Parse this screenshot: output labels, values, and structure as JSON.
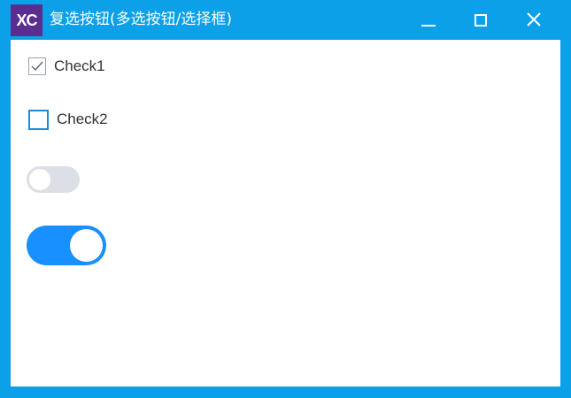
{
  "window": {
    "logo_text": "XC",
    "title": "复选按钮(多选按钮/选择框)",
    "controls": [
      "minimize-icon",
      "maximize-icon",
      "close-icon"
    ],
    "colors": {
      "titlebar": "#0ba0e8",
      "logo_bg": "#5a2d91",
      "accent": "#1890ff"
    }
  },
  "checkboxes": [
    {
      "label": "Check1",
      "checked": true
    },
    {
      "label": "Check2",
      "checked": false
    }
  ],
  "switches": [
    {
      "on": false
    },
    {
      "on": true
    }
  ]
}
